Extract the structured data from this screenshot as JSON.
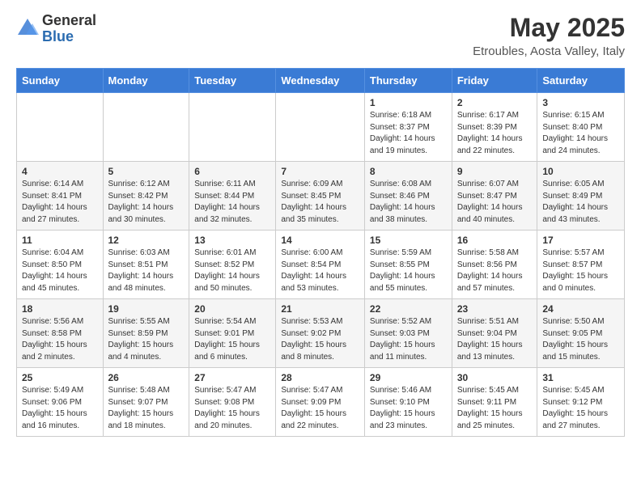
{
  "logo": {
    "general": "General",
    "blue": "Blue"
  },
  "title": "May 2025",
  "subtitle": "Etroubles, Aosta Valley, Italy",
  "headers": [
    "Sunday",
    "Monday",
    "Tuesday",
    "Wednesday",
    "Thursday",
    "Friday",
    "Saturday"
  ],
  "weeks": [
    [
      {
        "day": "",
        "info": ""
      },
      {
        "day": "",
        "info": ""
      },
      {
        "day": "",
        "info": ""
      },
      {
        "day": "",
        "info": ""
      },
      {
        "day": "1",
        "info": "Sunrise: 6:18 AM\nSunset: 8:37 PM\nDaylight: 14 hours\nand 19 minutes."
      },
      {
        "day": "2",
        "info": "Sunrise: 6:17 AM\nSunset: 8:39 PM\nDaylight: 14 hours\nand 22 minutes."
      },
      {
        "day": "3",
        "info": "Sunrise: 6:15 AM\nSunset: 8:40 PM\nDaylight: 14 hours\nand 24 minutes."
      }
    ],
    [
      {
        "day": "4",
        "info": "Sunrise: 6:14 AM\nSunset: 8:41 PM\nDaylight: 14 hours\nand 27 minutes."
      },
      {
        "day": "5",
        "info": "Sunrise: 6:12 AM\nSunset: 8:42 PM\nDaylight: 14 hours\nand 30 minutes."
      },
      {
        "day": "6",
        "info": "Sunrise: 6:11 AM\nSunset: 8:44 PM\nDaylight: 14 hours\nand 32 minutes."
      },
      {
        "day": "7",
        "info": "Sunrise: 6:09 AM\nSunset: 8:45 PM\nDaylight: 14 hours\nand 35 minutes."
      },
      {
        "day": "8",
        "info": "Sunrise: 6:08 AM\nSunset: 8:46 PM\nDaylight: 14 hours\nand 38 minutes."
      },
      {
        "day": "9",
        "info": "Sunrise: 6:07 AM\nSunset: 8:47 PM\nDaylight: 14 hours\nand 40 minutes."
      },
      {
        "day": "10",
        "info": "Sunrise: 6:05 AM\nSunset: 8:49 PM\nDaylight: 14 hours\nand 43 minutes."
      }
    ],
    [
      {
        "day": "11",
        "info": "Sunrise: 6:04 AM\nSunset: 8:50 PM\nDaylight: 14 hours\nand 45 minutes."
      },
      {
        "day": "12",
        "info": "Sunrise: 6:03 AM\nSunset: 8:51 PM\nDaylight: 14 hours\nand 48 minutes."
      },
      {
        "day": "13",
        "info": "Sunrise: 6:01 AM\nSunset: 8:52 PM\nDaylight: 14 hours\nand 50 minutes."
      },
      {
        "day": "14",
        "info": "Sunrise: 6:00 AM\nSunset: 8:54 PM\nDaylight: 14 hours\nand 53 minutes."
      },
      {
        "day": "15",
        "info": "Sunrise: 5:59 AM\nSunset: 8:55 PM\nDaylight: 14 hours\nand 55 minutes."
      },
      {
        "day": "16",
        "info": "Sunrise: 5:58 AM\nSunset: 8:56 PM\nDaylight: 14 hours\nand 57 minutes."
      },
      {
        "day": "17",
        "info": "Sunrise: 5:57 AM\nSunset: 8:57 PM\nDaylight: 15 hours\nand 0 minutes."
      }
    ],
    [
      {
        "day": "18",
        "info": "Sunrise: 5:56 AM\nSunset: 8:58 PM\nDaylight: 15 hours\nand 2 minutes."
      },
      {
        "day": "19",
        "info": "Sunrise: 5:55 AM\nSunset: 8:59 PM\nDaylight: 15 hours\nand 4 minutes."
      },
      {
        "day": "20",
        "info": "Sunrise: 5:54 AM\nSunset: 9:01 PM\nDaylight: 15 hours\nand 6 minutes."
      },
      {
        "day": "21",
        "info": "Sunrise: 5:53 AM\nSunset: 9:02 PM\nDaylight: 15 hours\nand 8 minutes."
      },
      {
        "day": "22",
        "info": "Sunrise: 5:52 AM\nSunset: 9:03 PM\nDaylight: 15 hours\nand 11 minutes."
      },
      {
        "day": "23",
        "info": "Sunrise: 5:51 AM\nSunset: 9:04 PM\nDaylight: 15 hours\nand 13 minutes."
      },
      {
        "day": "24",
        "info": "Sunrise: 5:50 AM\nSunset: 9:05 PM\nDaylight: 15 hours\nand 15 minutes."
      }
    ],
    [
      {
        "day": "25",
        "info": "Sunrise: 5:49 AM\nSunset: 9:06 PM\nDaylight: 15 hours\nand 16 minutes."
      },
      {
        "day": "26",
        "info": "Sunrise: 5:48 AM\nSunset: 9:07 PM\nDaylight: 15 hours\nand 18 minutes."
      },
      {
        "day": "27",
        "info": "Sunrise: 5:47 AM\nSunset: 9:08 PM\nDaylight: 15 hours\nand 20 minutes."
      },
      {
        "day": "28",
        "info": "Sunrise: 5:47 AM\nSunset: 9:09 PM\nDaylight: 15 hours\nand 22 minutes."
      },
      {
        "day": "29",
        "info": "Sunrise: 5:46 AM\nSunset: 9:10 PM\nDaylight: 15 hours\nand 23 minutes."
      },
      {
        "day": "30",
        "info": "Sunrise: 5:45 AM\nSunset: 9:11 PM\nDaylight: 15 hours\nand 25 minutes."
      },
      {
        "day": "31",
        "info": "Sunrise: 5:45 AM\nSunset: 9:12 PM\nDaylight: 15 hours\nand 27 minutes."
      }
    ]
  ]
}
